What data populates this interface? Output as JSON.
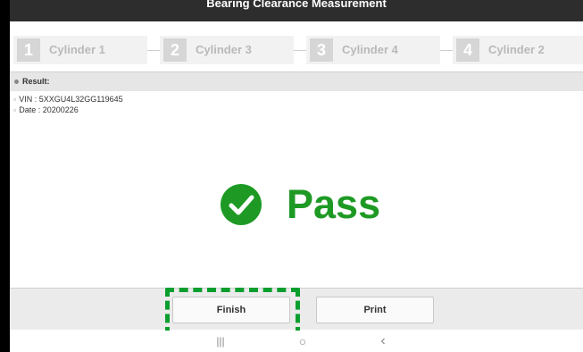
{
  "title": "Bearing Clearance Measurement",
  "steps": [
    {
      "number": "1",
      "label": "Cylinder 1"
    },
    {
      "number": "2",
      "label": "Cylinder 3"
    },
    {
      "number": "3",
      "label": "Cylinder 4"
    },
    {
      "number": "4",
      "label": "Cylinder 2"
    }
  ],
  "result": {
    "heading": "Result:",
    "vin": "VIN : 5XXGU4L32GG119645",
    "date": "Date : 20200226"
  },
  "status": {
    "text": "Pass",
    "icon": "check-circle-icon",
    "color": "#1e9a24"
  },
  "buttons": {
    "finish": "Finish",
    "print": "Print"
  },
  "navbar": {
    "recents": "|||",
    "home": "○",
    "back": "‹"
  },
  "colors": {
    "highlight": "#0a9e2e",
    "pass": "#1e9a24"
  }
}
